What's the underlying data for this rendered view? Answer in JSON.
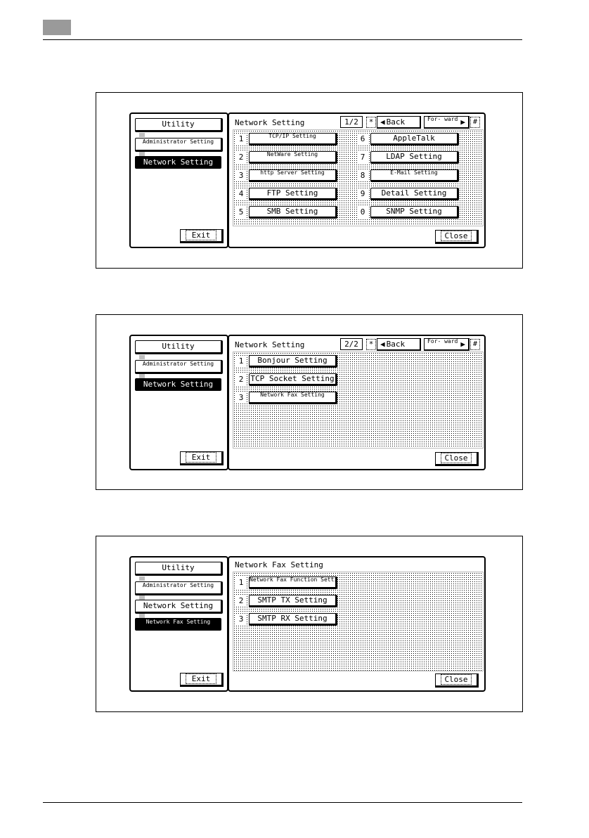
{
  "page": {
    "chapter_mark_color": "#9a9a9a"
  },
  "screens": [
    {
      "left": {
        "utility": "Utility",
        "admin": "Administrator Setting",
        "network": "Network Setting",
        "exit": "Exit"
      },
      "right": {
        "title": "Network Setting",
        "page": "1/2",
        "star": "*",
        "hash": "#",
        "back": "Back",
        "forward": "For- ward",
        "close": "Close",
        "items": [
          {
            "num": "1",
            "label": "TCP/IP Setting"
          },
          {
            "num": "2",
            "label": "NetWare Setting"
          },
          {
            "num": "3",
            "label": "http Server Setting"
          },
          {
            "num": "4",
            "label": "FTP Setting"
          },
          {
            "num": "5",
            "label": "SMB Setting"
          },
          {
            "num": "6",
            "label": "AppleTalk"
          },
          {
            "num": "7",
            "label": "LDAP Setting"
          },
          {
            "num": "8",
            "label": "E-Mail Setting"
          },
          {
            "num": "9",
            "label": "Detail Setting"
          },
          {
            "num": "0",
            "label": "SNMP Setting"
          }
        ]
      }
    },
    {
      "left": {
        "utility": "Utility",
        "admin": "Administrator Setting",
        "network": "Network Setting",
        "exit": "Exit"
      },
      "right": {
        "title": "Network Setting",
        "page": "2/2",
        "star": "*",
        "hash": "#",
        "back": "Back",
        "forward": "For- ward",
        "close": "Close",
        "items": [
          {
            "num": "1",
            "label": "Bonjour Setting"
          },
          {
            "num": "2",
            "label": "TCP Socket Setting"
          },
          {
            "num": "3",
            "label": "Network Fax Setting"
          }
        ]
      }
    },
    {
      "left": {
        "utility": "Utility",
        "admin": "Administrator Setting",
        "network": "Network Setting",
        "netfax": "Network Fax Setting",
        "exit": "Exit"
      },
      "right": {
        "title": "Network Fax Setting",
        "close": "Close",
        "items": [
          {
            "num": "1",
            "label": "Network Fax Function Settings"
          },
          {
            "num": "2",
            "label": "SMTP TX Setting"
          },
          {
            "num": "3",
            "label": "SMTP RX Setting"
          }
        ]
      }
    }
  ]
}
